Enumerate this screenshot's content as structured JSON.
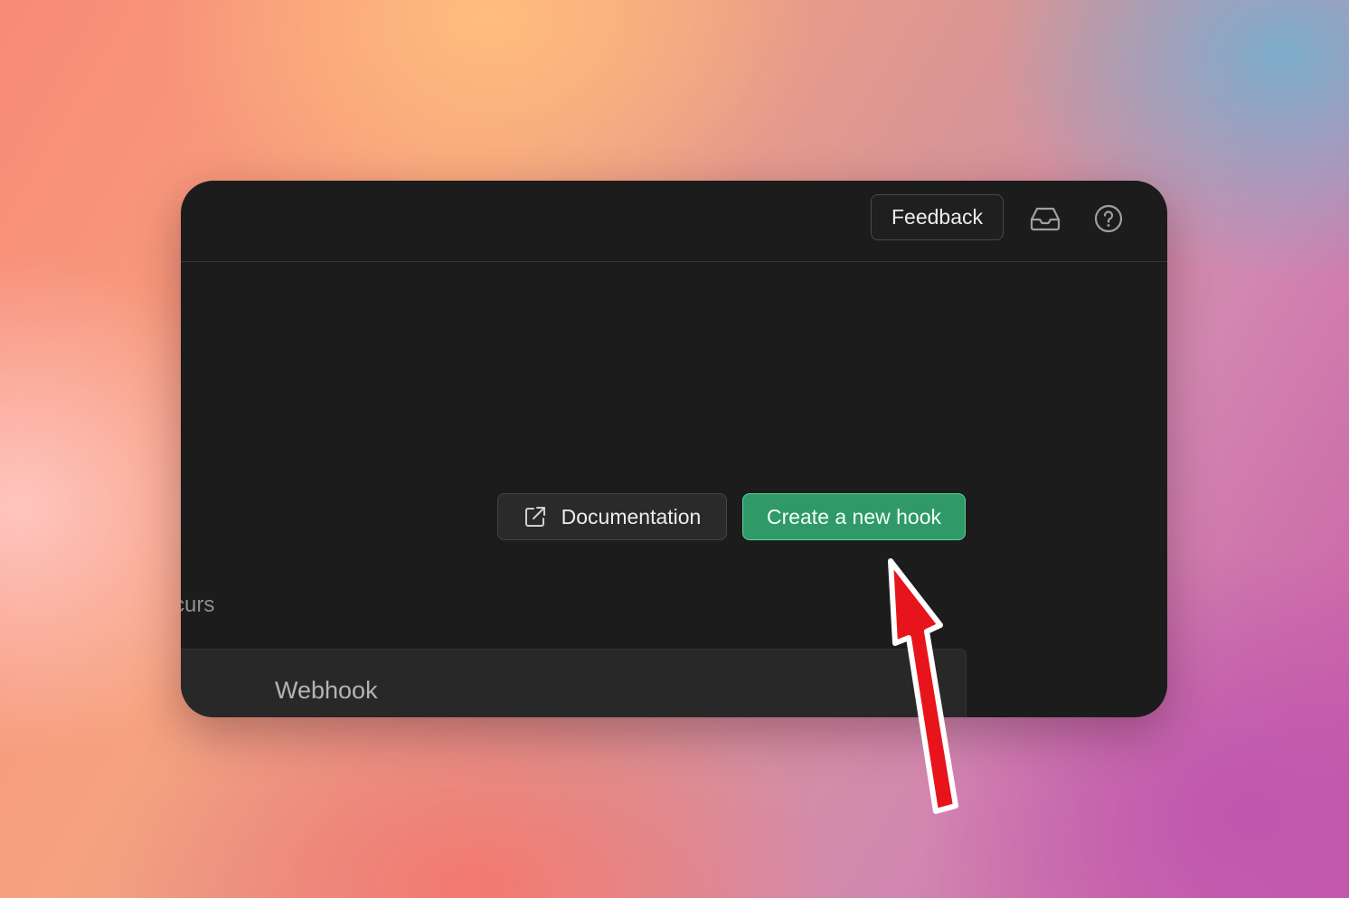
{
  "header": {
    "feedback_label": "Feedback",
    "inbox_icon": "inbox-icon",
    "help_icon": "help-circle-icon"
  },
  "main": {
    "clipped_text": "curs",
    "documentation_label": "Documentation",
    "documentation_icon": "external-link-icon",
    "create_hook_label": "Create a new hook"
  },
  "table": {
    "column_header": "Webhook"
  },
  "annotation": {
    "arrow_color": "#e8141b",
    "arrow_icon": "red-arrow-annotation"
  },
  "colors": {
    "window_bg": "#1c1c1c",
    "accent_green": "#2f9968",
    "accent_green_border": "#5fd39a"
  }
}
